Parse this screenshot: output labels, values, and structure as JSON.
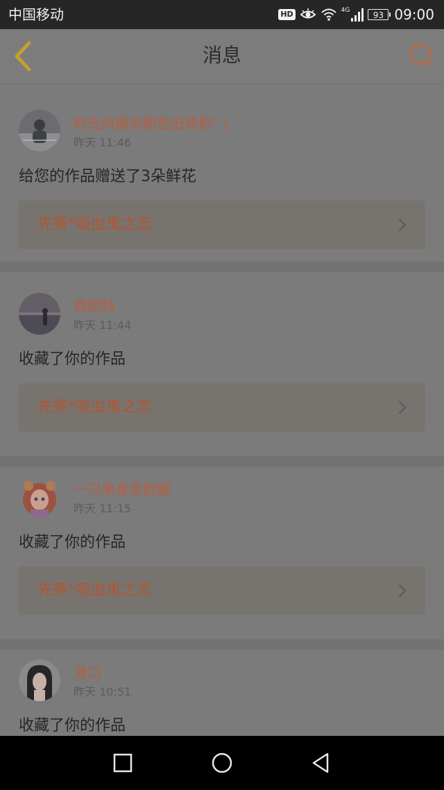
{
  "status_bar": {
    "carrier": "中国移动",
    "hd": "HD",
    "network": "4G",
    "battery": "93",
    "time": "09:00",
    "icons": [
      "eye-comfort-icon",
      "wifi-icon",
      "cellular-signal-icon"
    ]
  },
  "header": {
    "title": "消息",
    "back_icon": "back-chevron-icon",
    "search_icon": "search-icon",
    "accent_color": "#c4a12a"
  },
  "messages": [
    {
      "username": "时光风靡的那些旧背影° |",
      "time": "昨天 11:46",
      "text": "给您的作品赠送了3朵鲜花",
      "work_title": "先祭*吸血鬼之恋"
    },
    {
      "username": "简妮特",
      "time": "昨天 11:44",
      "text": "收藏了你的作品",
      "work_title": "先祭*吸血鬼之恋"
    },
    {
      "username": "一只单身菲欧娜",
      "time": "昨天 11:15",
      "text": "收藏了你的作品",
      "work_title": "先祭*吸血鬼之恋"
    },
    {
      "username": "港口",
      "time": "昨天 10:51",
      "text": "收藏了你的作品"
    }
  ],
  "system_nav": {
    "icons": [
      "recent-apps-icon",
      "home-icon",
      "back-icon"
    ]
  },
  "colors": {
    "username": "#b85d3d",
    "work_title": "#b4552e",
    "search_accent": "#c26a3a"
  }
}
